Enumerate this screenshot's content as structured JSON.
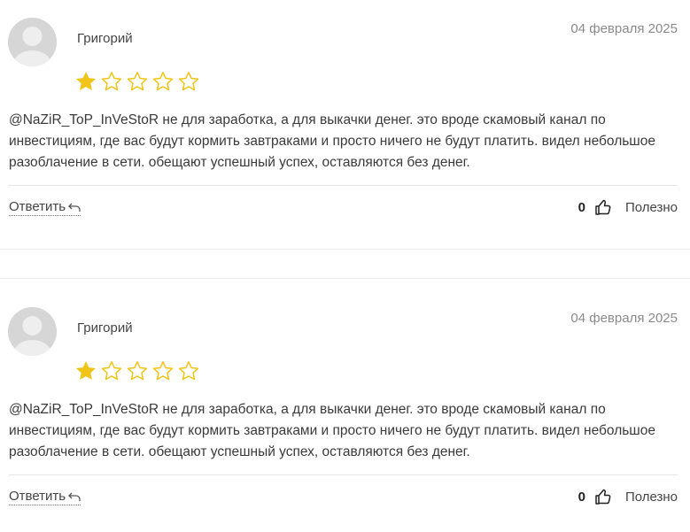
{
  "reviews": [
    {
      "author": "Григорий",
      "date": "04 февраля 2025",
      "rating": 1,
      "max_rating": 5,
      "text": "@NaZiR_ToP_InVeStoR не для заработка, а для выкачки денег. это вроде скамовый канал по инвестициям, где вас будут кормить завтраками и просто ничего не будут платить. видел небольшое разоблачение в сети. обещают успешный успех, оставляются без денег.",
      "reply_label": "Ответить",
      "likes": "0",
      "useful_label": "Полезно"
    },
    {
      "author": "Григорий",
      "date": "04 февраля 2025",
      "rating": 1,
      "max_rating": 5,
      "text": "@NaZiR_ToP_InVeStoR не для заработка, а для выкачки денег. это вроде скамовый канал по инвестициям, где вас будут кормить завтраками и просто ничего не будут платить. видел небольшое разоблачение в сети. обещают успешный успех, оставляются без денег.",
      "reply_label": "Ответить",
      "likes": "0",
      "useful_label": "Полезно"
    }
  ],
  "colors": {
    "star_filled": "#f0c419",
    "star_empty": "#f0c419",
    "avatar_bg": "#d9d9d9"
  },
  "icons": [
    "avatar-placeholder-icon",
    "star-icon",
    "reply-arrow-icon",
    "thumbs-up-icon"
  ]
}
